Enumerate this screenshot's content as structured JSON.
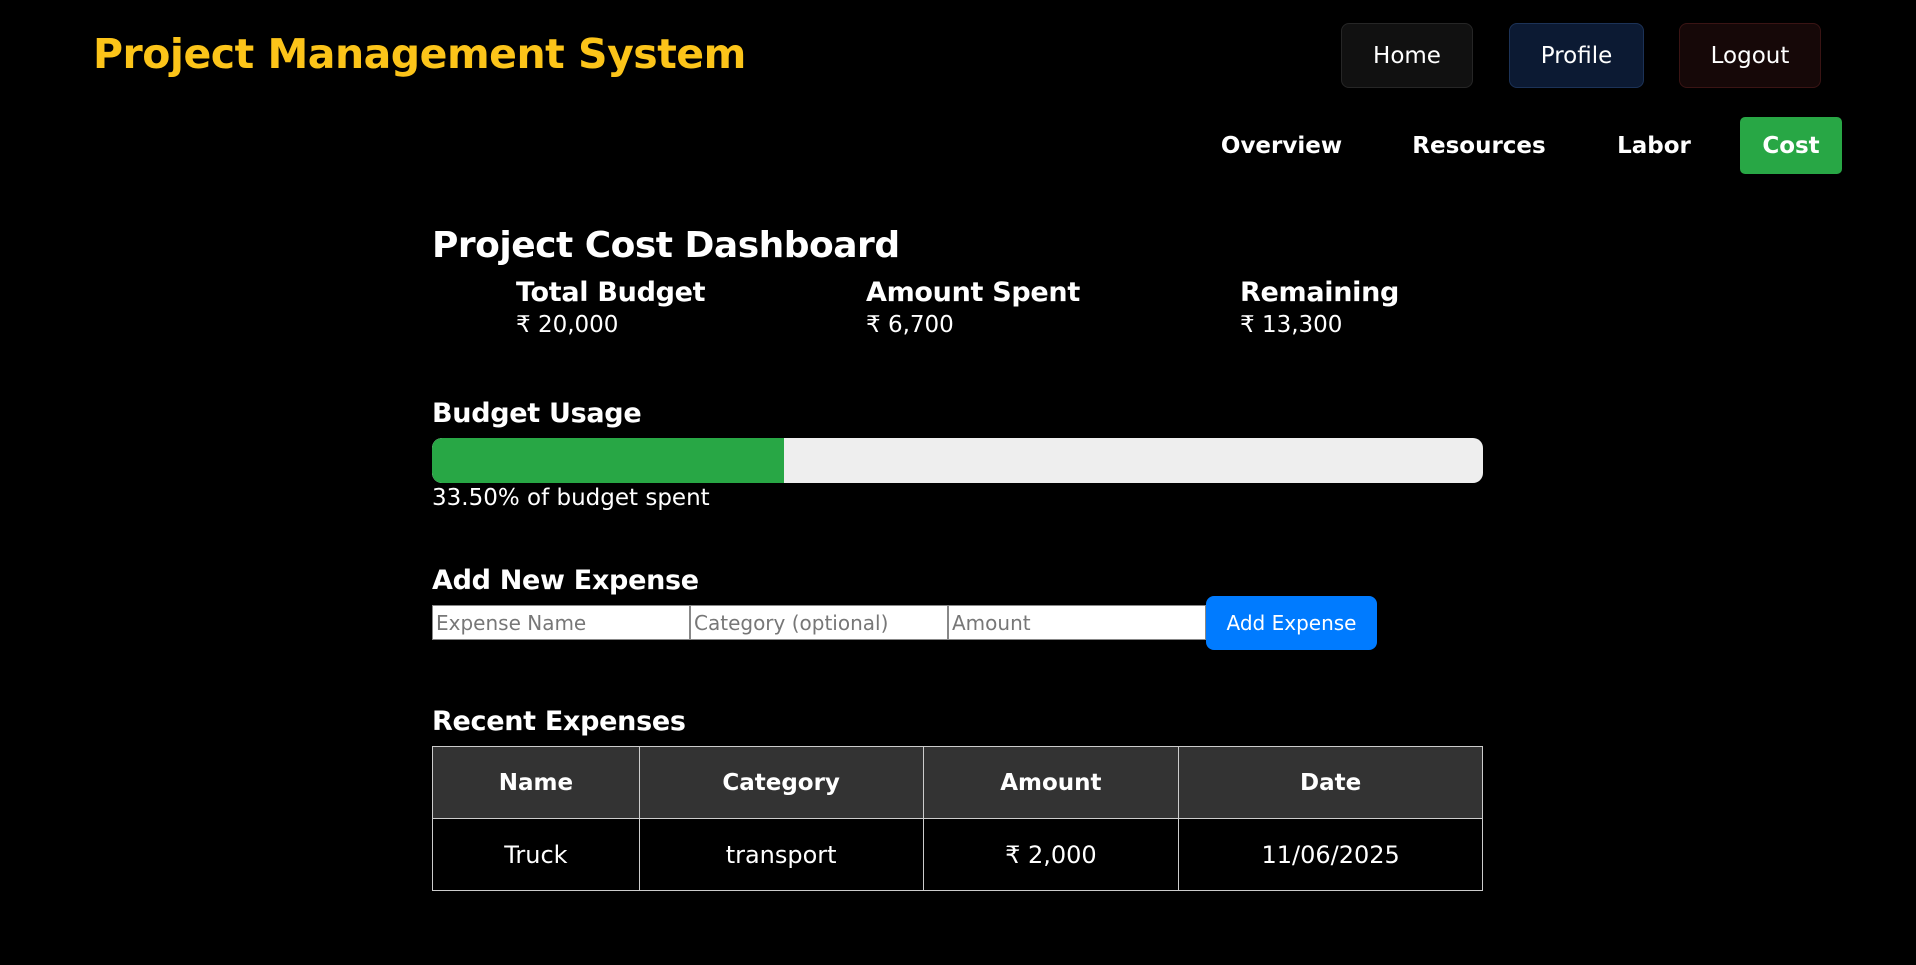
{
  "header": {
    "title": "Project Management System",
    "nav": {
      "home": "Home",
      "profile": "Profile",
      "logout": "Logout"
    }
  },
  "tabs": [
    {
      "label": "Overview"
    },
    {
      "label": "Resources"
    },
    {
      "label": "Labor"
    },
    {
      "label": "Cost",
      "active": true
    }
  ],
  "dashboard": {
    "title": "Project Cost Dashboard",
    "stats": {
      "budget": {
        "label": "Total Budget",
        "value": "₹ 20,000"
      },
      "spent": {
        "label": "Amount Spent",
        "value": "₹ 6,700"
      },
      "remaining": {
        "label": "Remaining",
        "value": "₹ 13,300"
      }
    },
    "usage": {
      "title": "Budget Usage",
      "percent": 33.5,
      "text": "33.50% of budget spent"
    },
    "add_expense": {
      "title": "Add New Expense",
      "name_placeholder": "Expense Name",
      "category_placeholder": "Category (optional)",
      "amount_placeholder": "Amount",
      "button_label": "Add Expense"
    },
    "recent": {
      "title": "Recent Expenses",
      "columns": [
        "Name",
        "Category",
        "Amount",
        "Date"
      ],
      "rows": [
        [
          "Truck",
          "transport",
          "₹ 2,000",
          "11/06/2025"
        ]
      ]
    }
  },
  "colors": {
    "title": "#fcc419",
    "active_tab": "#28a745",
    "progress_fill": "#28a745",
    "add_button": "#007bff"
  }
}
